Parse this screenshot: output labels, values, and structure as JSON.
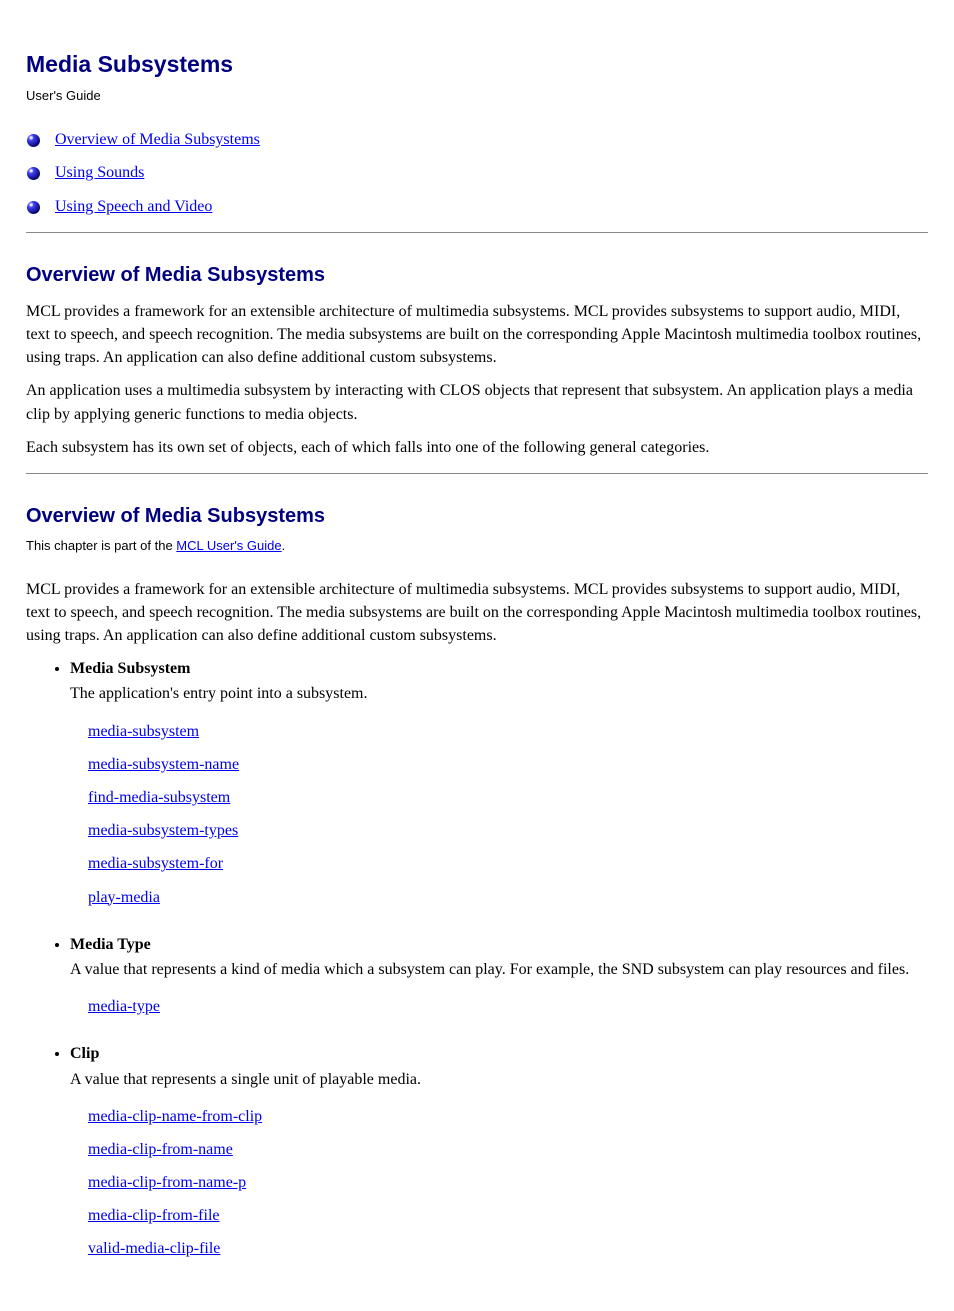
{
  "page": {
    "title": "Media Subsystems",
    "sub_label": "User's Guide"
  },
  "nav": [
    "Overview of Media Subsystems",
    "Using Sounds",
    "Using Speech and Video"
  ],
  "overview": {
    "heading": "Overview of Media Subsystems",
    "p1": "MCL provides a framework for an extensible architecture of multimedia subsystems. MCL provides subsystems to support audio, MIDI, text to speech, and speech recognition. The media subsystems are built on the corresponding Apple Macintosh multimedia toolbox routines, using traps. An application can also define additional custom subsystems.",
    "p2": "An application uses a multimedia subsystem by interacting with CLOS objects that represent that subsystem. An application plays a media clip by applying generic functions to media objects.",
    "p3": "Each subsystem has its own set of objects, each of which falls into one of the following general categories."
  },
  "detail": {
    "heading": "Overview of Media Subsystems",
    "guide_link_prefix": "This chapter is part of the ",
    "guide_link_text": "MCL User's Guide",
    "guide_link_suffix": ".",
    "p1": "MCL provides a framework for an extensible architecture of multimedia subsystems. MCL provides subsystems to support audio, MIDI, text to speech, and speech recognition. The media subsystems are built on the corresponding Apple Macintosh multimedia toolbox routines, using traps. An application can also define additional custom subsystems."
  },
  "groups": [
    {
      "title": "Media Subsystem",
      "desc": "The application's entry point into a subsystem.",
      "children": [
        "media-subsystem",
        "media-subsystem-name",
        "find-media-subsystem",
        "media-subsystem-types",
        "media-subsystem-for",
        "play-media"
      ]
    },
    {
      "title": "Media Type",
      "desc": "A value that represents a kind of media which a subsystem can play. For example, the SND subsystem can play resources and files.",
      "children": [
        "media-type"
      ]
    },
    {
      "title": "Clip",
      "desc": "A value that represents a single unit of playable media.",
      "children": [
        "media-clip-name-from-clip",
        "media-clip-from-name",
        "media-clip-from-name-p",
        "media-clip-from-file",
        "valid-media-clip-file"
      ]
    }
  ]
}
